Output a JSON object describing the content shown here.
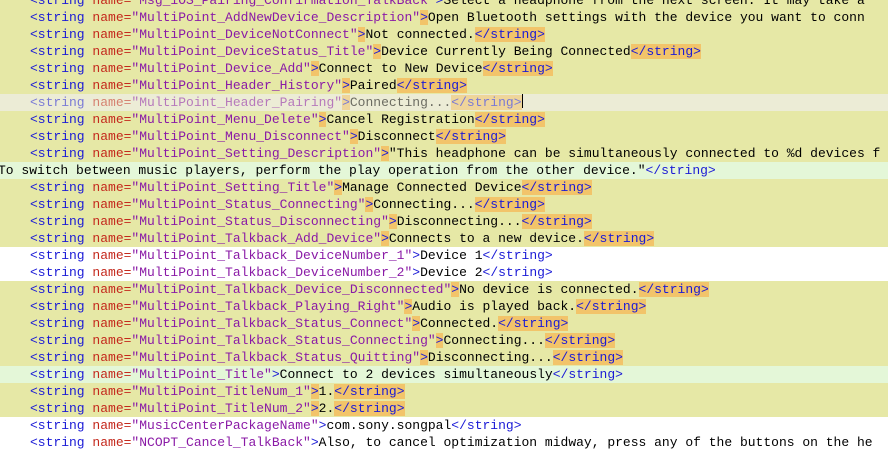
{
  "colors": {
    "tag": "#1a1ad6",
    "attr": "#c4281c",
    "value": "#8a1aa6",
    "line_yellow": "#e6e8a6",
    "line_green": "#e4f7d8",
    "match_highlight": "#f2c46a"
  },
  "syntax": {
    "open_tag": "<string",
    "attr_name": " name=",
    "tag_close": ">",
    "close_tag": "</string>"
  },
  "lines": [
    {
      "type": "s",
      "bg": "y",
      "name": "\"Msg_iOS_Pairing_Confirmation_TalkBack\"",
      "text": "Select a headphone from the next screen. It may take a",
      "hl": false,
      "end": false
    },
    {
      "type": "s",
      "bg": "y",
      "name": "\"MultiPoint_AddNewDevice_Description\"",
      "text": "Open Bluetooth settings with the device you want to conn",
      "hl": true,
      "end": false
    },
    {
      "type": "s",
      "bg": "y",
      "name": "\"MultiPoint_DeviceNotConnect\"",
      "text": "Not connected.",
      "hl": true,
      "end": true
    },
    {
      "type": "s",
      "bg": "y",
      "name": "\"MultiPoint_DeviceStatus_Title\"",
      "text": "Device Currently Being Connected",
      "hl": true,
      "end": true
    },
    {
      "type": "s",
      "bg": "y",
      "name": "\"MultiPoint_Device_Add\"",
      "text": "Connect to New Device",
      "hl": true,
      "end": true
    },
    {
      "type": "s",
      "bg": "y",
      "name": "\"MultiPoint_Header_History\"",
      "text": "Paired",
      "hl": true,
      "end": true
    },
    {
      "type": "s",
      "bg": "cur",
      "name": "\"MultiPoint_Header_Pairing\"",
      "text": "Connecting...",
      "hl": true,
      "end": true,
      "caret": true
    },
    {
      "type": "s",
      "bg": "y",
      "name": "\"MultiPoint_Menu_Delete\"",
      "text": "Cancel Registration",
      "hl": true,
      "end": true
    },
    {
      "type": "s",
      "bg": "y",
      "name": "\"MultiPoint_Menu_Disconnect\"",
      "text": "Disconnect",
      "hl": true,
      "end": true
    },
    {
      "type": "s",
      "bg": "y",
      "name": "\"MultiPoint_Setting_Description\"",
      "text": "\"This headphone can be simultaneously connected to %d devices f",
      "hl": true,
      "end": false
    },
    {
      "type": "c",
      "bg": "g",
      "text": "To switch between music players, perform the play operation from the other device.\""
    },
    {
      "type": "s",
      "bg": "y",
      "name": "\"MultiPoint_Setting_Title\"",
      "text": "Manage Connected Device",
      "hl": true,
      "end": true
    },
    {
      "type": "s",
      "bg": "y",
      "name": "\"MultiPoint_Status_Connecting\"",
      "text": "Connecting...",
      "hl": true,
      "end": true
    },
    {
      "type": "s",
      "bg": "y",
      "name": "\"MultiPoint_Status_Disconnecting\"",
      "text": "Disconnecting...",
      "hl": true,
      "end": true
    },
    {
      "type": "s",
      "bg": "y",
      "name": "\"MultiPoint_Talkback_Add_Device\"",
      "text": "Connects to a new device.",
      "hl": true,
      "end": true
    },
    {
      "type": "s",
      "bg": "w",
      "name": "\"MultiPoint_Talkback_DeviceNumber_1\"",
      "text": "Device 1",
      "hl": false,
      "end": true
    },
    {
      "type": "s",
      "bg": "w",
      "name": "\"MultiPoint_Talkback_DeviceNumber_2\"",
      "text": "Device 2",
      "hl": false,
      "end": true
    },
    {
      "type": "s",
      "bg": "y",
      "name": "\"MultiPoint_Talkback_Device_Disconnected\"",
      "text": "No device is connected.",
      "hl": true,
      "end": true
    },
    {
      "type": "s",
      "bg": "y",
      "name": "\"MultiPoint_Talkback_Playing_Right\"",
      "text": "Audio is played back.",
      "hl": true,
      "end": true
    },
    {
      "type": "s",
      "bg": "y",
      "name": "\"MultiPoint_Talkback_Status_Connect\"",
      "text": "Connected.",
      "hl": true,
      "end": true
    },
    {
      "type": "s",
      "bg": "y",
      "name": "\"MultiPoint_Talkback_Status_Connecting\"",
      "text": "Connecting...",
      "hl": true,
      "end": true
    },
    {
      "type": "s",
      "bg": "y",
      "name": "\"MultiPoint_Talkback_Status_Quitting\"",
      "text": "Disconnecting...",
      "hl": true,
      "end": true
    },
    {
      "type": "s",
      "bg": "g",
      "name": "\"MultiPoint_Title\"",
      "text": "Connect to 2 devices simultaneously",
      "hl": false,
      "end": true
    },
    {
      "type": "s",
      "bg": "y",
      "name": "\"MultiPoint_TitleNum_1\"",
      "text": "1.",
      "hl": true,
      "end": true
    },
    {
      "type": "s",
      "bg": "y",
      "name": "\"MultiPoint_TitleNum_2\"",
      "text": "2.",
      "hl": true,
      "end": true
    },
    {
      "type": "s",
      "bg": "w",
      "name": "\"MusicCenterPackageName\"",
      "text": "com.sony.songpal",
      "hl": false,
      "end": true
    },
    {
      "type": "s",
      "bg": "w",
      "name": "\"NCOPT_Cancel_TalkBack\"",
      "text": "Also, to cancel optimization midway, press any of the buttons on the he",
      "hl": false,
      "end": false
    }
  ]
}
